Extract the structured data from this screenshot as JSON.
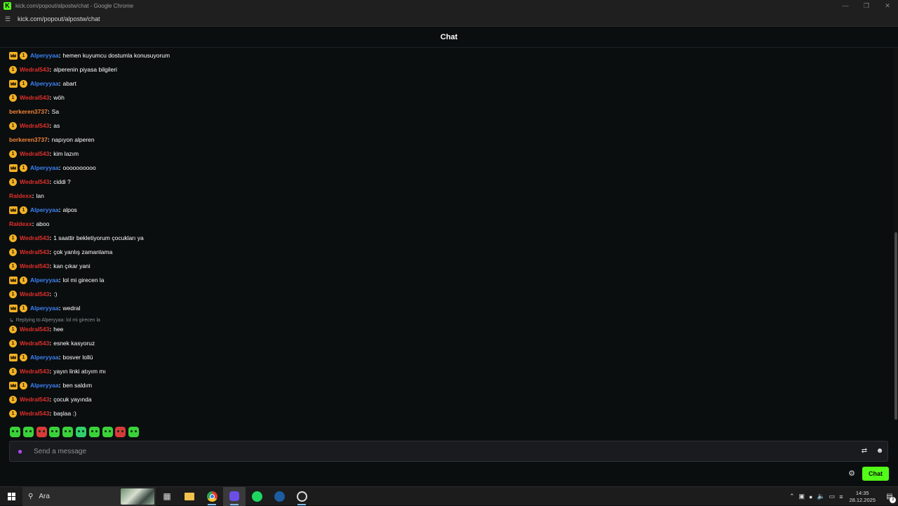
{
  "browser": {
    "window_title": "kick.com/popout/alpostw/chat - Google Chrome",
    "url": "kick.com/popout/alpostw/chat",
    "logo_letter": "K"
  },
  "chat": {
    "header": "Chat",
    "sub_badge_number": "1",
    "reply_context": "Replying to Alperyyaa: lol mi girecen la",
    "input_placeholder": "Send a message",
    "send_label": "Chat",
    "colors": {
      "brand_green": "#53fc18",
      "user_blue": "#3b82f6",
      "user_red": "#e0302b",
      "user_orange": "#f2843a",
      "badge_gold": "#f4b223"
    },
    "messages": [
      {
        "user": "Alperyyaa",
        "text": "hemen kuyumcu dostumla konusuyorum",
        "badges": [
          "crown",
          "sub"
        ],
        "color": "blue"
      },
      {
        "user": "Wedral543",
        "text": "alperenin piyasa bilgileri",
        "badges": [
          "sub"
        ],
        "color": "red"
      },
      {
        "user": "Alperyyaa",
        "text": "abart",
        "badges": [
          "crown",
          "sub"
        ],
        "color": "blue"
      },
      {
        "user": "Wedral543",
        "text": "wöh",
        "badges": [
          "sub"
        ],
        "color": "red"
      },
      {
        "user": "berkeren3737",
        "text": "Sa",
        "badges": [],
        "color": "orange"
      },
      {
        "user": "Wedral543",
        "text": "as",
        "badges": [
          "sub"
        ],
        "color": "red"
      },
      {
        "user": "berkeren3737",
        "text": "napıyon alperen",
        "badges": [],
        "color": "orange"
      },
      {
        "user": "Wedral543",
        "text": "kim lazım",
        "badges": [
          "sub"
        ],
        "color": "red"
      },
      {
        "user": "Alperyyaa",
        "text": "oooooooooo",
        "badges": [
          "crown",
          "sub"
        ],
        "color": "blue"
      },
      {
        "user": "Wedral543",
        "text": "ciddi ?",
        "badges": [
          "sub"
        ],
        "color": "red"
      },
      {
        "user": "Raldexx",
        "text": "lan",
        "badges": [],
        "color": "red"
      },
      {
        "user": "Alperyyaa",
        "text": "alpos",
        "badges": [
          "crown",
          "sub"
        ],
        "color": "blue"
      },
      {
        "user": "Raldexx",
        "text": "aboo",
        "badges": [],
        "color": "red"
      },
      {
        "user": "Wedral543",
        "text": "1 saattir bekletiyorum çocukları ya",
        "badges": [
          "sub"
        ],
        "color": "red"
      },
      {
        "user": "Wedral543",
        "text": "çok yanlış zamanlama",
        "badges": [
          "sub"
        ],
        "color": "red"
      },
      {
        "user": "Wedral543",
        "text": "kan çıkar yani",
        "badges": [
          "sub"
        ],
        "color": "red"
      },
      {
        "user": "Alperyyaa",
        "text": "lol mi girecen la",
        "badges": [
          "crown",
          "sub"
        ],
        "color": "blue"
      },
      {
        "user": "Wedral543",
        "text": ":)",
        "badges": [
          "sub"
        ],
        "color": "red"
      },
      {
        "user": "Alperyyaa",
        "text": "wedral",
        "badges": [
          "crown",
          "sub"
        ],
        "color": "blue"
      },
      {
        "user": "Wedral543",
        "text": "hee",
        "badges": [
          "sub"
        ],
        "color": "red"
      },
      {
        "user": "Wedral543",
        "text": "esnek kasyoruz",
        "badges": [
          "sub"
        ],
        "color": "red"
      },
      {
        "user": "Alperyyaa",
        "text": "bosver lollü",
        "badges": [
          "crown",
          "sub"
        ],
        "color": "blue"
      },
      {
        "user": "Wedral543",
        "text": "yayın linki atıyım mı",
        "badges": [
          "sub"
        ],
        "color": "red"
      },
      {
        "user": "Alperyyaa",
        "text": "ben saldım",
        "badges": [
          "crown",
          "sub"
        ],
        "color": "blue"
      },
      {
        "user": "Wedral543",
        "text": "çocuk yayında",
        "badges": [
          "sub"
        ],
        "color": "red"
      },
      {
        "user": "Wedral543",
        "text": "başlaa :)",
        "badges": [
          "sub"
        ],
        "color": "red"
      }
    ],
    "emotes": [
      "emote-1",
      "emote-2",
      "emote-3",
      "emote-4",
      "emote-5",
      "emote-6",
      "emote-7",
      "emote-8",
      "emote-9",
      "emote-10"
    ]
  },
  "taskbar": {
    "search_placeholder": "Ara",
    "time": "14:35",
    "date": "28.12.2025",
    "notification_count": "3",
    "apps": [
      "chrome-icon",
      "discord-icon",
      "spotify-icon",
      "steam-icon",
      "obs-icon"
    ]
  }
}
